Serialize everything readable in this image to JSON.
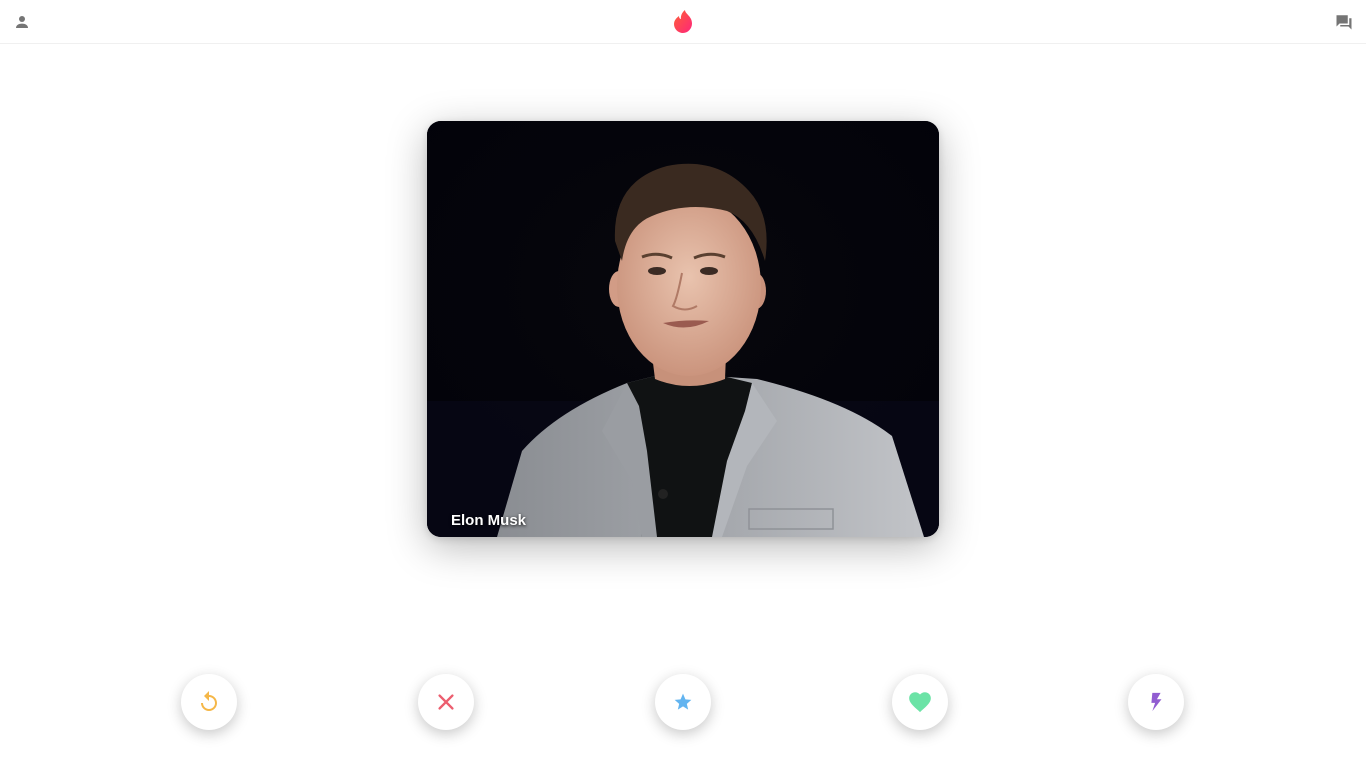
{
  "header": {
    "icons": {
      "profile": "person-icon",
      "logo": "flame-logo-icon",
      "messages": "forum-icon"
    },
    "brand_color": "#fe3c72"
  },
  "card": {
    "name": "Elon Musk"
  },
  "actions": [
    {
      "name": "rewind",
      "icon": "replay-icon",
      "color": "#f5b748"
    },
    {
      "name": "nope",
      "icon": "close-icon",
      "color": "#ec5e6f"
    },
    {
      "name": "super-like",
      "icon": "star-icon",
      "color": "#62b4f0"
    },
    {
      "name": "like",
      "icon": "heart-icon",
      "color": "#6be3a6"
    },
    {
      "name": "boost",
      "icon": "bolt-icon",
      "color": "#915dd1"
    }
  ]
}
